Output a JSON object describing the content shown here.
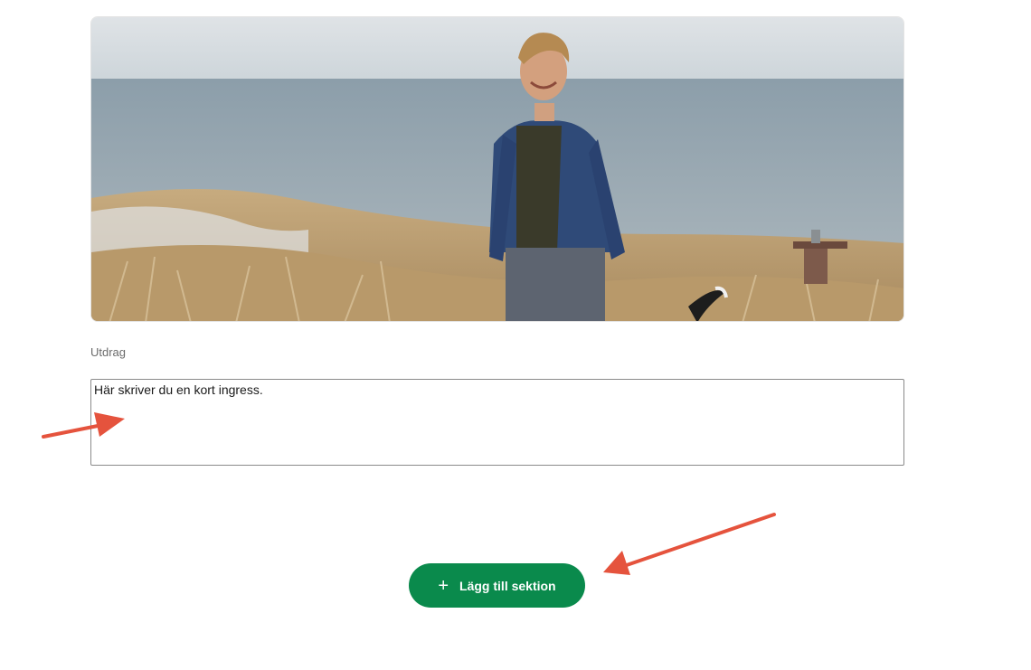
{
  "hero_image": {
    "icon": "photo-man-walking-dogs-on-dunes"
  },
  "excerpt": {
    "label": "Utdrag",
    "value": "Här skriver du en kort ingress."
  },
  "add_section_button": {
    "icon": "plus-icon",
    "label": "Lägg till sektion"
  },
  "annotation_arrows": {
    "color": "#e5533d"
  },
  "colors": {
    "button_bg": "#0a8a4c",
    "label_text": "#6b6b6b",
    "arrow": "#e5533d"
  }
}
